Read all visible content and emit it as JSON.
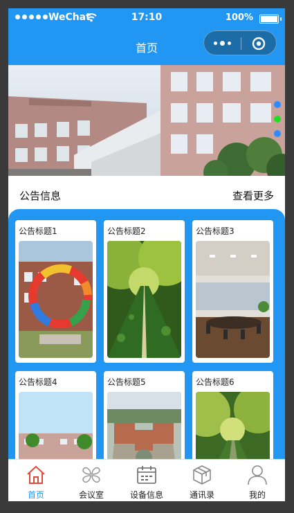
{
  "status_bar": {
    "carrier": "WeChat",
    "time": "17:10",
    "battery": "100%"
  },
  "nav": {
    "title": "首页"
  },
  "banner": {
    "dots": [
      {
        "color": "#2f8cff"
      },
      {
        "color": "#22dd22"
      },
      {
        "color": "#2f8cff"
      }
    ]
  },
  "notice": {
    "title": "公告信息",
    "more": "查看更多"
  },
  "cards": [
    {
      "title": "公告标题1",
      "image": "colorful-ring-sculpture"
    },
    {
      "title": "公告标题2",
      "image": "tree-lined-path"
    },
    {
      "title": "公告标题3",
      "image": "conference-room"
    },
    {
      "title": "公告标题4",
      "image": "campus-buildings"
    },
    {
      "title": "公告标题5",
      "image": "campus-aerial-view"
    },
    {
      "title": "公告标题6",
      "image": "tree-lined-road"
    }
  ],
  "tabs": [
    {
      "label": "首页",
      "icon": "home-icon",
      "active": true
    },
    {
      "label": "会议室",
      "icon": "meeting-room-icon",
      "active": false
    },
    {
      "label": "设备信息",
      "icon": "device-info-icon",
      "active": false
    },
    {
      "label": "通讯录",
      "icon": "contacts-icon",
      "active": false
    },
    {
      "label": "我的",
      "icon": "profile-icon",
      "active": false
    }
  ],
  "colors": {
    "primary": "#2196f3",
    "active_tab": "#2196f3"
  }
}
